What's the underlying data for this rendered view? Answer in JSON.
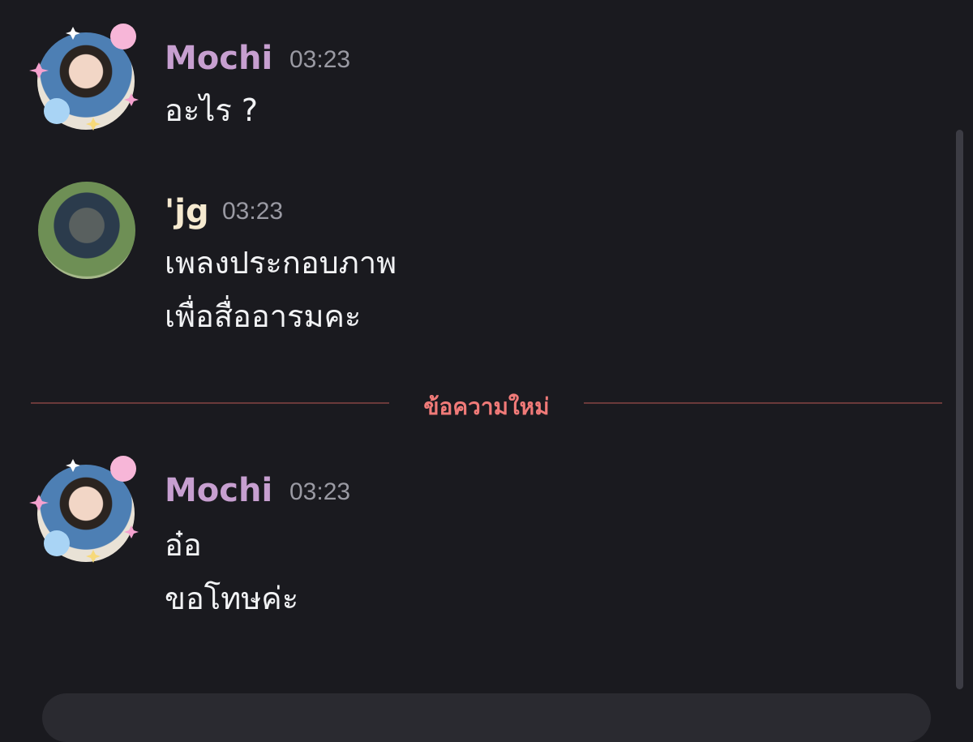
{
  "colors": {
    "background": "#1a1a1f",
    "mochi_name": "#c79fd0",
    "jg_name": "#f6ead0",
    "new_messages": "#f07a78",
    "divider": "#6b3a3a",
    "timestamp": "#9a9aa3"
  },
  "messages": [
    {
      "author": "Mochi",
      "time": "03:23",
      "lines": [
        "อะไร ?"
      ]
    },
    {
      "author": "'jg",
      "time": "03:23",
      "lines": [
        "เพลงประกอบภาพ",
        "เพื่อสื่ออารมคะ"
      ]
    },
    {
      "author": "Mochi",
      "time": "03:23",
      "lines": [
        "อ๋อ",
        "ขอโทษค่ะ"
      ]
    }
  ],
  "divider": {
    "label": "ข้อความใหม่"
  }
}
